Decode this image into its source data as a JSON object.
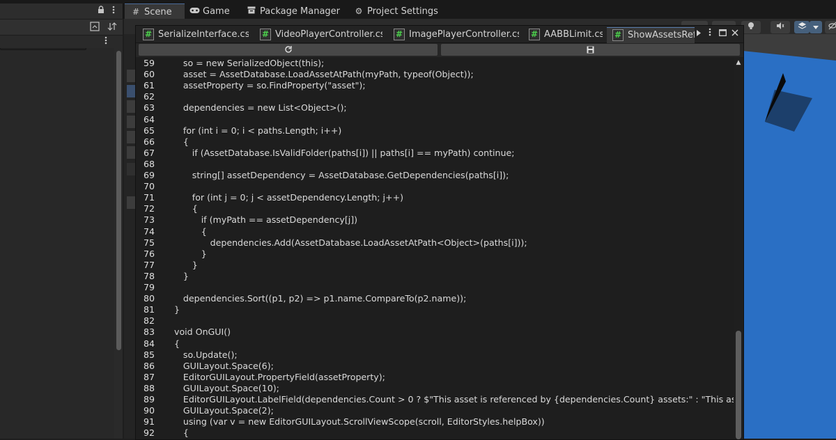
{
  "window_tabs": [
    {
      "label": "Scene",
      "icon": "grid-icon",
      "active": true
    },
    {
      "label": "Game",
      "icon": "gamepad-icon",
      "active": false
    },
    {
      "label": "Package Manager",
      "icon": "package-icon",
      "active": false
    },
    {
      "label": "Project Settings",
      "icon": "gear-icon",
      "active": false
    }
  ],
  "editor": {
    "tabs": [
      {
        "label": "SerializeInterface.cs",
        "active": false
      },
      {
        "label": "VideoPlayerController.cs",
        "active": false
      },
      {
        "label": "ImagePlayerController.cs",
        "active": false
      },
      {
        "label": "AABBLimit.cs",
        "active": false
      },
      {
        "label": "ShowAssetsRef",
        "active": true
      }
    ],
    "icons": {
      "tab_file": "csharp-file-icon",
      "tab_overflow": "chevron-right-icon",
      "menu": "kebab-menu-icon",
      "maximize": "maximize-icon",
      "close": "close-icon",
      "reload": "refresh-icon",
      "save": "save-icon"
    },
    "scroll_position": 0.79,
    "code_lines": [
      {
        "n": "59",
        "text": "so = new SerializedObject(this);",
        "indent": 1
      },
      {
        "n": "60",
        "text": "asset = AssetDatabase.LoadAssetAtPath(myPath, typeof(Object));",
        "indent": 1
      },
      {
        "n": "61",
        "text": "assetProperty = so.FindProperty(\"asset\");",
        "indent": 1
      },
      {
        "n": "62",
        "text": "",
        "indent": 0
      },
      {
        "n": "63",
        "text": "dependencies = new List<Object>();",
        "indent": 1
      },
      {
        "n": "64",
        "text": "",
        "indent": 0
      },
      {
        "n": "65",
        "text": "for (int i = 0; i < paths.Length; i++)",
        "indent": 1
      },
      {
        "n": "66",
        "text": "{",
        "indent": 1
      },
      {
        "n": "67",
        "text": "if (AssetDatabase.IsValidFolder(paths[i]) || paths[i] == myPath) continue;",
        "indent": 2
      },
      {
        "n": "68",
        "text": "",
        "indent": 0
      },
      {
        "n": "69",
        "text": "string[] assetDependency = AssetDatabase.GetDependencies(paths[i]);",
        "indent": 2
      },
      {
        "n": "70",
        "text": "",
        "indent": 0
      },
      {
        "n": "71",
        "text": "for (int j = 0; j < assetDependency.Length; j++)",
        "indent": 2
      },
      {
        "n": "72",
        "text": "{",
        "indent": 2
      },
      {
        "n": "73",
        "text": "if (myPath == assetDependency[j])",
        "indent": 3
      },
      {
        "n": "74",
        "text": "{",
        "indent": 3
      },
      {
        "n": "75",
        "text": "dependencies.Add(AssetDatabase.LoadAssetAtPath<Object>(paths[i]));",
        "indent": 4
      },
      {
        "n": "76",
        "text": "}",
        "indent": 3
      },
      {
        "n": "77",
        "text": "}",
        "indent": 2
      },
      {
        "n": "78",
        "text": "}",
        "indent": 1
      },
      {
        "n": "79",
        "text": "",
        "indent": 0
      },
      {
        "n": "80",
        "text": "dependencies.Sort((p1, p2) => p1.name.CompareTo(p2.name));",
        "indent": 1
      },
      {
        "n": "81",
        "text": "}",
        "indent": 0
      },
      {
        "n": "82",
        "text": "",
        "indent": 0
      },
      {
        "n": "83",
        "text": "void OnGUI()",
        "indent": 0
      },
      {
        "n": "84",
        "text": "{",
        "indent": 0
      },
      {
        "n": "85",
        "text": "so.Update();",
        "indent": 1
      },
      {
        "n": "86",
        "text": "GUILayout.Space(6);",
        "indent": 1
      },
      {
        "n": "87",
        "text": "EditorGUILayout.PropertyField(assetProperty);",
        "indent": 1
      },
      {
        "n": "88",
        "text": "GUILayout.Space(10);",
        "indent": 1
      },
      {
        "n": "89",
        "text": "EditorGUILayout.LabelField(dependencies.Count > 0 ? $\"This asset is referenced by {dependencies.Count} assets:\" : \"This asset has",
        "indent": 1
      },
      {
        "n": "90",
        "text": "GUILayout.Space(2);",
        "indent": 1
      },
      {
        "n": "91",
        "text": "using (var v = new EditorGUILayout.ScrollViewScope(scroll, EditorStyles.helpBox))",
        "indent": 1
      },
      {
        "n": "92",
        "text": "{",
        "indent": 1
      }
    ]
  },
  "left_panel": {
    "icons": [
      "lock-icon",
      "kebab-menu-icon",
      "search-by-type-icon",
      "sort-icon",
      "kebab-menu-icon"
    ]
  },
  "scene": {
    "background_color": "#3d3d3d",
    "floor_color": "#2a6fc4",
    "object_color": "#1c3f6b"
  },
  "colors": {
    "accent": "#5a7dad",
    "csharp_icon_green": "#4cd24c",
    "editor_bg": "#1e1e1e"
  }
}
